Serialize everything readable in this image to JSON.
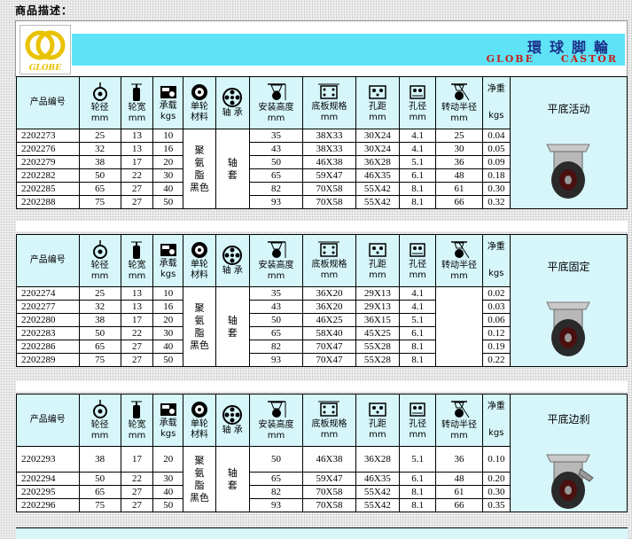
{
  "page": {
    "label": "商品描述："
  },
  "header": {
    "brand_cn": "環球脚輪",
    "brand_en_1": "GLOBE",
    "brand_en_2": "CASTOR",
    "logo_text": "GLOBE"
  },
  "columns": {
    "code": "产品编号",
    "wheel_dia": [
      "轮径",
      "mm"
    ],
    "wheel_width": [
      "轮宽",
      "mm"
    ],
    "load": [
      "承载",
      "kgs"
    ],
    "material": [
      "单轮",
      "材料"
    ],
    "bearing": "轴 承",
    "height": [
      "安装高度",
      "mm"
    ],
    "plate": [
      "底板规格",
      "mm"
    ],
    "hole_dist": [
      "孔距",
      "mm"
    ],
    "hole_dia": [
      "孔径",
      "mm"
    ],
    "swivel_radius": [
      "转动半径",
      "mm"
    ],
    "net_weight": [
      "净重",
      "kgs"
    ]
  },
  "sections": [
    {
      "title": "平底活动",
      "material": "聚氨脂黑色",
      "bearing": "轴套",
      "rows": [
        [
          "2202273",
          "25",
          "13",
          "10",
          "35",
          "38X33",
          "30X24",
          "4.1",
          "25",
          "0.04"
        ],
        [
          "2202276",
          "32",
          "13",
          "16",
          "43",
          "38X33",
          "30X24",
          "4.1",
          "30",
          "0.05"
        ],
        [
          "2202279",
          "38",
          "17",
          "20",
          "50",
          "46X38",
          "36X28",
          "5.1",
          "36",
          "0.09"
        ],
        [
          "2202282",
          "50",
          "22",
          "30",
          "65",
          "59X47",
          "46X35",
          "6.1",
          "48",
          "0.18"
        ],
        [
          "2202285",
          "65",
          "27",
          "40",
          "82",
          "70X58",
          "55X42",
          "8.1",
          "61",
          "0.30"
        ],
        [
          "2202288",
          "75",
          "27",
          "50",
          "93",
          "70X58",
          "55X42",
          "8.1",
          "66",
          "0.32"
        ]
      ]
    },
    {
      "title": "平底固定",
      "material": "聚氨脂黑色",
      "bearing": "轴套",
      "rows": [
        [
          "2202274",
          "25",
          "13",
          "10",
          "35",
          "36X20",
          "29X13",
          "4.1",
          "",
          "0.02"
        ],
        [
          "2202277",
          "32",
          "13",
          "16",
          "43",
          "36X20",
          "29X13",
          "4.1",
          "",
          "0.03"
        ],
        [
          "2202280",
          "38",
          "17",
          "20",
          "50",
          "46X25",
          "36X15",
          "5.1",
          "",
          "0.06"
        ],
        [
          "2202283",
          "50",
          "22",
          "30",
          "65",
          "58X40",
          "45X25",
          "6.1",
          "",
          "0.12"
        ],
        [
          "2202286",
          "65",
          "27",
          "40",
          "82",
          "70X47",
          "55X28",
          "8.1",
          "",
          "0.19"
        ],
        [
          "2202289",
          "75",
          "27",
          "50",
          "93",
          "70X47",
          "55X28",
          "8.1",
          "",
          "0.22"
        ]
      ]
    },
    {
      "title": "平底边刹",
      "material": "聚氨脂黑色",
      "bearing": "轴套",
      "rows": [
        [
          "2202293",
          "38",
          "17",
          "20",
          "50",
          "46X38",
          "36X28",
          "5.1",
          "36",
          "0.10"
        ],
        [
          "2202294",
          "50",
          "22",
          "30",
          "65",
          "59X47",
          "46X35",
          "6.1",
          "48",
          "0.20"
        ],
        [
          "2202295",
          "65",
          "27",
          "40",
          "82",
          "70X58",
          "55X42",
          "8.1",
          "61",
          "0.30"
        ],
        [
          "2202296",
          "75",
          "27",
          "50",
          "93",
          "70X58",
          "55X42",
          "8.1",
          "66",
          "0.35"
        ]
      ]
    }
  ]
}
